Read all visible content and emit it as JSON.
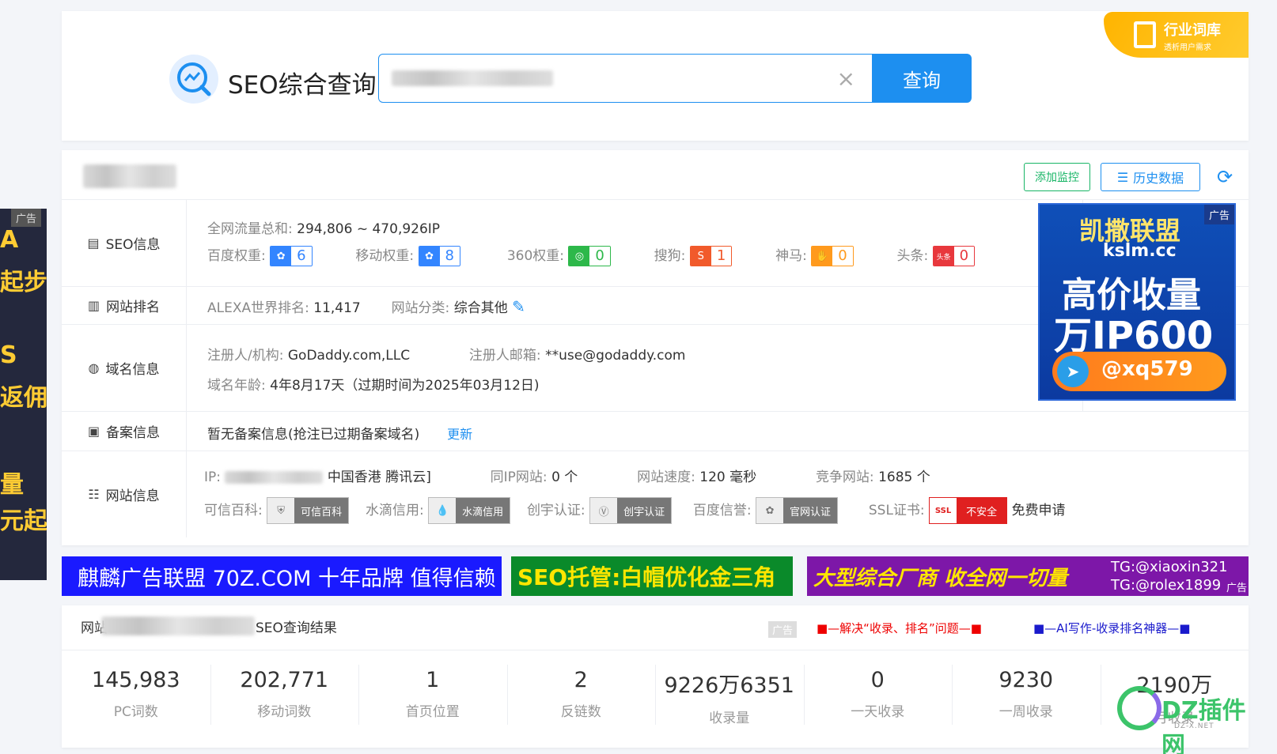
{
  "header": {
    "title": "SEO综合查询",
    "search_button": "查询",
    "clear_symbol": "×",
    "corner_badge": {
      "title": "行业词库",
      "subtitle": "透析用户需求"
    }
  },
  "actions": {
    "monitor": "添加监控",
    "history": "历史数据"
  },
  "seo": {
    "label": "SEO信息",
    "traffic_key": "全网流量总和:",
    "traffic_value": "294,806 ~ 470,926IP",
    "baidu_key": "百度权重:",
    "baidu_value": "6",
    "mobile_key": "移动权重:",
    "mobile_value": "8",
    "w360_key": "360权重:",
    "w360_value": "0",
    "sogou_key": "搜狗:",
    "sogou_value": "1",
    "shenma_key": "神马:",
    "shenma_value": "0",
    "toutiao_key": "头条:",
    "toutiao_value": "0",
    "toutiao_icon_text": "头条"
  },
  "rank": {
    "label": "网站排名",
    "alexa_key": "ALEXA世界排名:",
    "alexa_value": "11,417",
    "category_key": "网站分类:",
    "category_value": "综合其他"
  },
  "domain": {
    "label": "域名信息",
    "registrant_key": "注册人/机构:",
    "registrant_value": "GoDaddy.com,LLC",
    "email_key": "注册人邮箱:",
    "email_value": "**use@godaddy.com",
    "age_key": "域名年龄:",
    "age_value": "4年8月17天（过期时间为2025年03月12日)"
  },
  "icp": {
    "label": "备案信息",
    "value": "暂无备案信息(抢注已过期备案域名)",
    "update": "更新"
  },
  "site": {
    "label": "网站信息",
    "ip_key": "IP:",
    "ip_location": "中国香港 腾讯云]",
    "same_ip_key": "同IP网站:",
    "same_ip_value": "0 个",
    "speed_key": "网站速度:",
    "speed_value": "120 毫秒",
    "compete_key": "竞争网站:",
    "compete_value": "1685 个",
    "kexin_key": "可信百科:",
    "kexin_badge": "可信百科",
    "shuidi_key": "水滴信用:",
    "shuidi_badge": "水滴信用",
    "chuangyu_key": "创宇认证:",
    "chuangyu_badge": "创宇认证",
    "baidu_rep_key": "百度信誉:",
    "baidu_rep_badge": "官网认证",
    "ssl_key": "SSL证书:",
    "ssl_badge": "不安全",
    "ssl_icon_text": "SSL",
    "ssl_apply": "免费申请"
  },
  "right_ad": {
    "tag": "广告",
    "line1": "凯撒联盟",
    "line2": "kslm.cc",
    "line3": "高价收量",
    "line4": "万IP600",
    "handle": "@xq579"
  },
  "left_ad": {
    "tag": "广告",
    "lines": [
      "A",
      "起步",
      "S",
      "返佣",
      "量",
      "元起"
    ]
  },
  "banners": {
    "b1": "麒麟广告联盟 70Z.COM 十年品牌 值得信赖",
    "b2": "SEO托管:白帽优化金三角",
    "b3_main": "大型综合厂商 收全网一切量",
    "b3_tg1": "TG:@xiaoxin321",
    "b3_tg2": "TG:@rolex1899",
    "b3_tag": "广告"
  },
  "results": {
    "title_prefix": "网站",
    "title_suffix": "SEO查询结果",
    "ad_tag": "广告",
    "red_link": "■—解决“收录、排名”问题—■",
    "blue_link": "■—AI写作-收录排名神器—■",
    "stats": [
      {
        "value": "145,983",
        "label": "PC词数"
      },
      {
        "value": "202,771",
        "label": "移动词数"
      },
      {
        "value": "1",
        "label": "首页位置"
      },
      {
        "value": "2",
        "label": "反链数"
      },
      {
        "value": "9226万6351",
        "label": "收录量"
      },
      {
        "value": "0",
        "label": "一天收录"
      },
      {
        "value": "9230",
        "label": "一周收录"
      },
      {
        "value": "2190万",
        "label": "月收录"
      }
    ]
  },
  "watermark": {
    "text": "DZ插件网",
    "sub": "DZ-X.NET"
  },
  "colors": {
    "primary": "#1d8ff0",
    "green": "#18b566",
    "gold": "#ffb400"
  }
}
